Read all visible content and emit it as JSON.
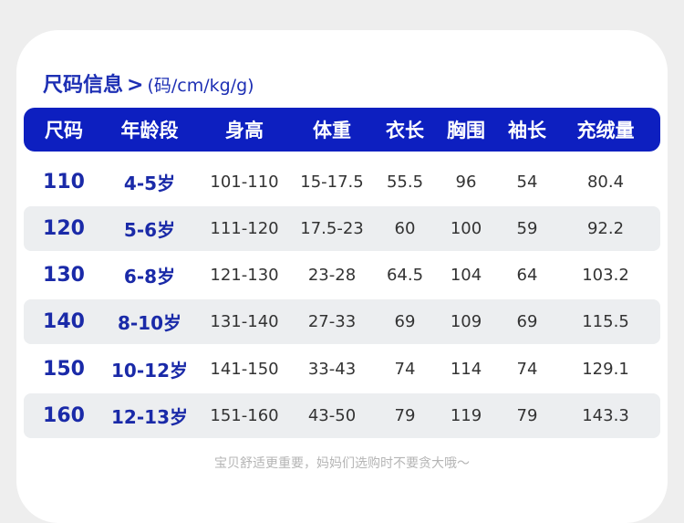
{
  "heading": {
    "title": "尺码信息",
    "arrow": ">",
    "units": "(码/cm/kg/g)"
  },
  "table": {
    "headers": [
      "尺码",
      "年龄段",
      "身高",
      "体重",
      "衣长",
      "胸围",
      "袖长",
      "充绒量"
    ],
    "rows": [
      [
        "110",
        "4-5岁",
        "101-110",
        "15-17.5",
        "55.5",
        "96",
        "54",
        "80.4"
      ],
      [
        "120",
        "5-6岁",
        "111-120",
        "17.5-23",
        "60",
        "100",
        "59",
        "92.2"
      ],
      [
        "130",
        "6-8岁",
        "121-130",
        "23-28",
        "64.5",
        "104",
        "64",
        "103.2"
      ],
      [
        "140",
        "8-10岁",
        "131-140",
        "27-33",
        "69",
        "109",
        "69",
        "115.5"
      ],
      [
        "150",
        "10-12岁",
        "141-150",
        "33-43",
        "74",
        "114",
        "74",
        "129.1"
      ],
      [
        "160",
        "12-13岁",
        "151-160",
        "43-50",
        "79",
        "119",
        "79",
        "143.3"
      ]
    ]
  },
  "footnote": "宝贝舒适更重要，妈妈们选购时不要贪大哦～",
  "colors": {
    "header_bg": "#0d1fc0",
    "accent_text": "#1a2aa8",
    "row_shade": "#eceef0"
  }
}
